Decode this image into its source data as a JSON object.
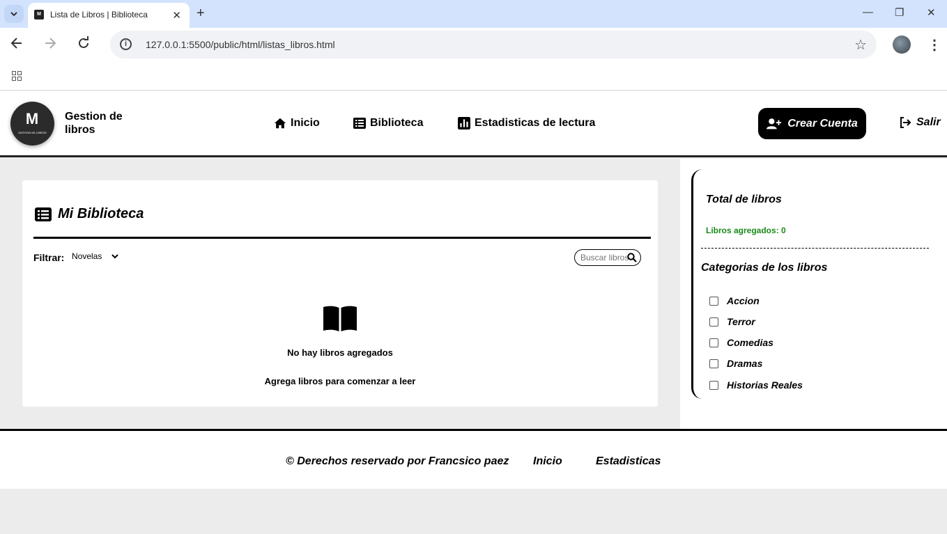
{
  "browser": {
    "tab_title": "Lista de Libros | Biblioteca",
    "favicon_text": "M",
    "url": "127.0.0.1:5500/public/html/listas_libros.html"
  },
  "header": {
    "logo_mark": "M",
    "logo_sub": "GESTION DE LIBROS",
    "brand": "Gestion de libros",
    "nav": [
      {
        "label": "Inicio",
        "icon": "home-icon"
      },
      {
        "label": "Biblioteca",
        "icon": "list-icon"
      },
      {
        "label": "Estadisticas de lectura",
        "icon": "chart-icon"
      }
    ],
    "create_account": "Crear Cuenta",
    "exit": "Salir"
  },
  "main": {
    "title": "Mi Biblioteca",
    "filter_label": "Filtrar:",
    "filter_value": "Novelas",
    "search_placeholder": "Buscar libros",
    "empty_title": "No hay libros agregados",
    "empty_subtitle": "Agrega libros para comenzar a leer"
  },
  "sidebar": {
    "total_title": "Total de libros",
    "count_text": "Libros agregados: 0",
    "categories_title": "Categorias de los libros",
    "categories": [
      "Accion",
      "Terror",
      "Comedias",
      "Dramas",
      "Historias Reales"
    ]
  },
  "footer": {
    "copyright": "© Derechos reservado por Francsico paez",
    "links": [
      "Inicio",
      "Estadisticas"
    ]
  },
  "colors": {
    "accent": "#000000",
    "count_green": "#1a8a1a",
    "page_bg": "#ececec",
    "tabstrip_bg": "#d3e3fd"
  }
}
